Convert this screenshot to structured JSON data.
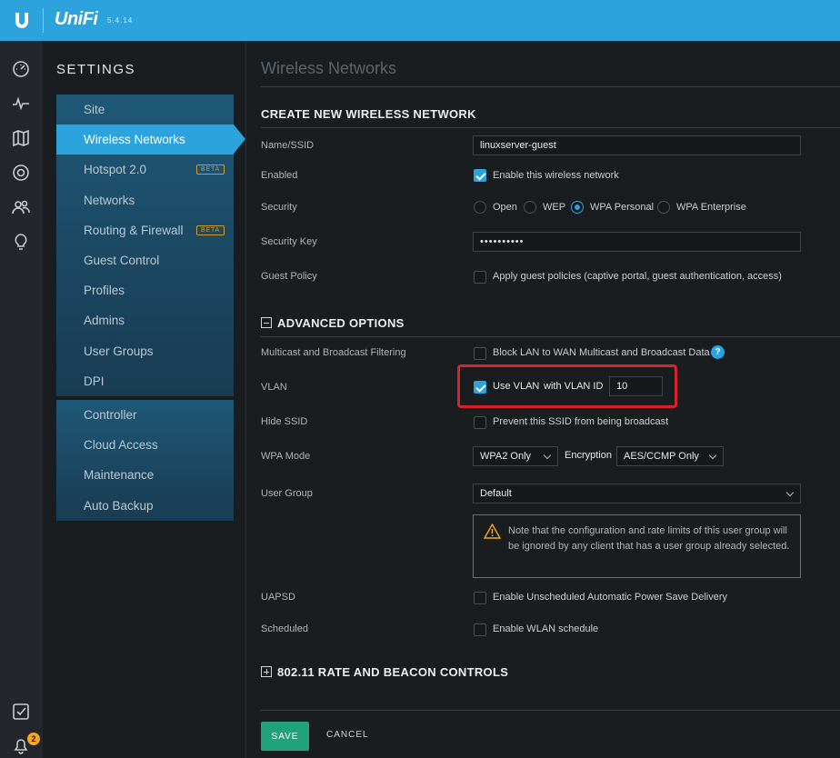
{
  "app": {
    "brand": "UniFi",
    "version": "5.4.14"
  },
  "settings": {
    "title": "SETTINGS",
    "group1": [
      {
        "label": "Site"
      },
      {
        "label": "Wireless Networks",
        "active": true
      },
      {
        "label": "Hotspot 2.0",
        "badge": "BETA"
      },
      {
        "label": "Networks"
      },
      {
        "label": "Routing & Firewall",
        "badge": "BETA"
      },
      {
        "label": "Guest Control"
      },
      {
        "label": "Profiles"
      },
      {
        "label": "Admins"
      },
      {
        "label": "User Groups"
      },
      {
        "label": "DPI"
      }
    ],
    "group2": [
      {
        "label": "Controller"
      },
      {
        "label": "Cloud Access"
      },
      {
        "label": "Maintenance"
      },
      {
        "label": "Auto Backup"
      }
    ]
  },
  "rail": {
    "icons": [
      "dashboard-icon",
      "statistics-icon",
      "map-icon",
      "devices-icon",
      "clients-icon",
      "insights-icon"
    ],
    "bottom_icons": [
      "tasks-icon",
      "alerts-icon"
    ],
    "alerts_count": "2"
  },
  "main": {
    "page_title": "Wireless Networks",
    "create_title": "CREATE NEW WIRELESS NETWORK",
    "name_label": "Name/SSID",
    "name_value": "linuxserver-guest",
    "enabled_label": "Enabled",
    "enabled_text": "Enable this wireless network",
    "security_label": "Security",
    "security_options": [
      "Open",
      "WEP",
      "WPA Personal",
      "WPA Enterprise"
    ],
    "security_selected": "WPA Personal",
    "key_label": "Security Key",
    "key_value": "••••••••••",
    "guest_label": "Guest Policy",
    "guest_text": "Apply guest policies (captive portal, guest authentication, access)",
    "advanced_title": "ADVANCED OPTIONS",
    "multicast_label": "Multicast and Broadcast Filtering",
    "multicast_text": "Block LAN to WAN Multicast and Broadcast Data",
    "help": "?",
    "vlan_label": "VLAN",
    "vlan_text": "Use VLAN",
    "vlan_id_text": "with VLAN ID",
    "vlan_id_value": "10",
    "hide_label": "Hide SSID",
    "hide_text": "Prevent this SSID from being broadcast",
    "wpa_label": "WPA Mode",
    "wpa_value": "WPA2 Only",
    "encryption_label": "Encryption",
    "encryption_value": "AES/CCMP Only",
    "usergroup_label": "User Group",
    "usergroup_value": "Default",
    "notice": "Note that the configuration and rate limits of this user group will be ignored by any client that has a user group already selected.",
    "uapsd_label": "UAPSD",
    "uapsd_text": "Enable Unscheduled Automatic Power Save Delivery",
    "scheduled_label": "Scheduled",
    "scheduled_text": "Enable WLAN schedule",
    "rate_title": "802.11 RATE AND BEACON CONTROLS",
    "save": "SAVE",
    "cancel": "CANCEL"
  },
  "colors": {
    "accent": "#2ca3dd",
    "save": "#21a37a",
    "highlight": "#d8232a",
    "beta": "#d19b2a"
  }
}
